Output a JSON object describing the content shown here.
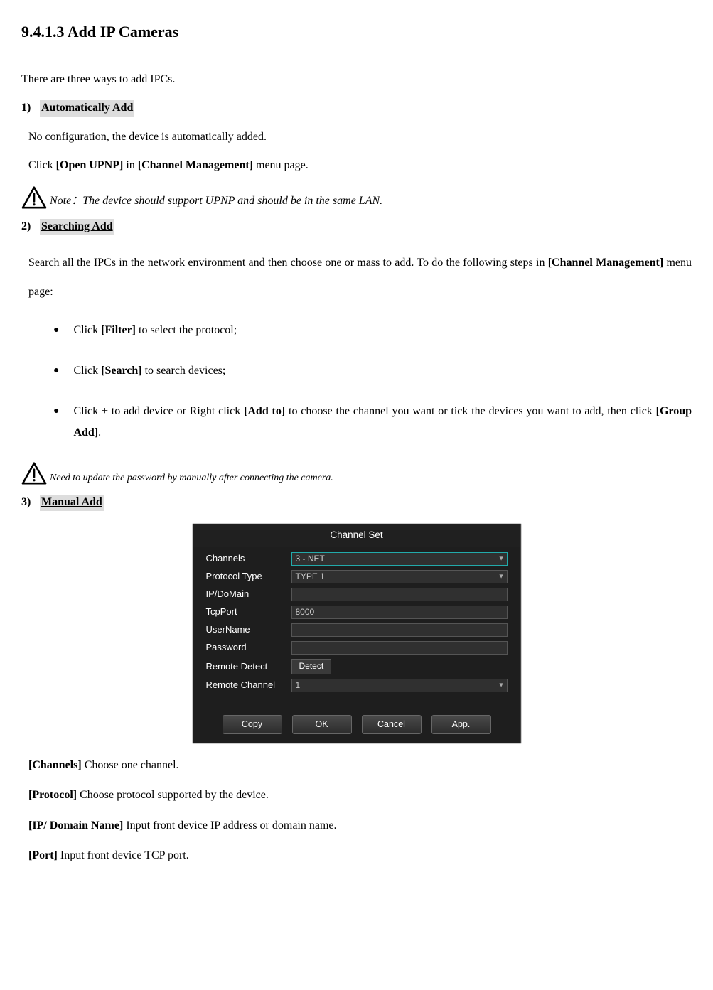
{
  "heading": "9.4.1.3 Add IP Cameras",
  "intro": "There are three ways to add IPCs.",
  "methods": [
    {
      "num": "1)",
      "title": "Automatically Add",
      "p1a": "No configuration, the device is automatically added.",
      "p2_pre": "Click ",
      "p2_b1": "[Open UPNP]",
      "p2_mid": " in ",
      "p2_b2": "[Channel Management]",
      "p2_post": " menu page.",
      "note_label": "Note：",
      "note_text": "The device should support UPNP and should be in the same LAN."
    },
    {
      "num": "2)",
      "title": "Searching Add",
      "p1_pre": "Search all the IPCs in the network environment and then choose one or mass to add. To do the following steps in ",
      "p1_b": "[Channel Management]",
      "p1_post": " menu page:",
      "bullets": [
        {
          "pre": "Click ",
          "b1": "[Filter]",
          "post": " to select the protocol;"
        },
        {
          "pre": "Click ",
          "b1": "[Search]",
          "post": " to search devices;"
        },
        {
          "pre": "Click + to add device or Right click ",
          "b1": "[Add to]",
          "mid": " to choose the channel you want or tick the devices you want to add, then click ",
          "b2": "[Group Add]",
          "post": "."
        }
      ],
      "note_text": "Need to update the password by manually after connecting the camera."
    },
    {
      "num": "3)",
      "title": "Manual Add"
    }
  ],
  "dialog": {
    "title": "Channel Set",
    "fields": {
      "channels_label": "Channels",
      "channels_value": "3 - NET",
      "protocol_label": "Protocol Type",
      "protocol_value": "TYPE 1",
      "ip_label": "IP/DoMain",
      "ip_value": "",
      "tcp_label": "TcpPort",
      "tcp_value": "8000",
      "user_label": "UserName",
      "user_value": "",
      "pass_label": "Password",
      "pass_value": "",
      "detect_label": "Remote Detect",
      "detect_btn": "Detect",
      "remote_label": "Remote Channel",
      "remote_value": "1"
    },
    "buttons": {
      "copy": "Copy",
      "ok": "OK",
      "cancel": "Cancel",
      "app": "App."
    }
  },
  "defs": [
    {
      "b": "[Channels]",
      "t": " Choose one channel."
    },
    {
      "b": "[Protocol]",
      "t": " Choose protocol supported by the device."
    },
    {
      "b": "[IP/ Domain Name]",
      "t": " Input front device IP address or domain name."
    },
    {
      "b": "[Port]",
      "t": " Input front device TCP port."
    }
  ]
}
